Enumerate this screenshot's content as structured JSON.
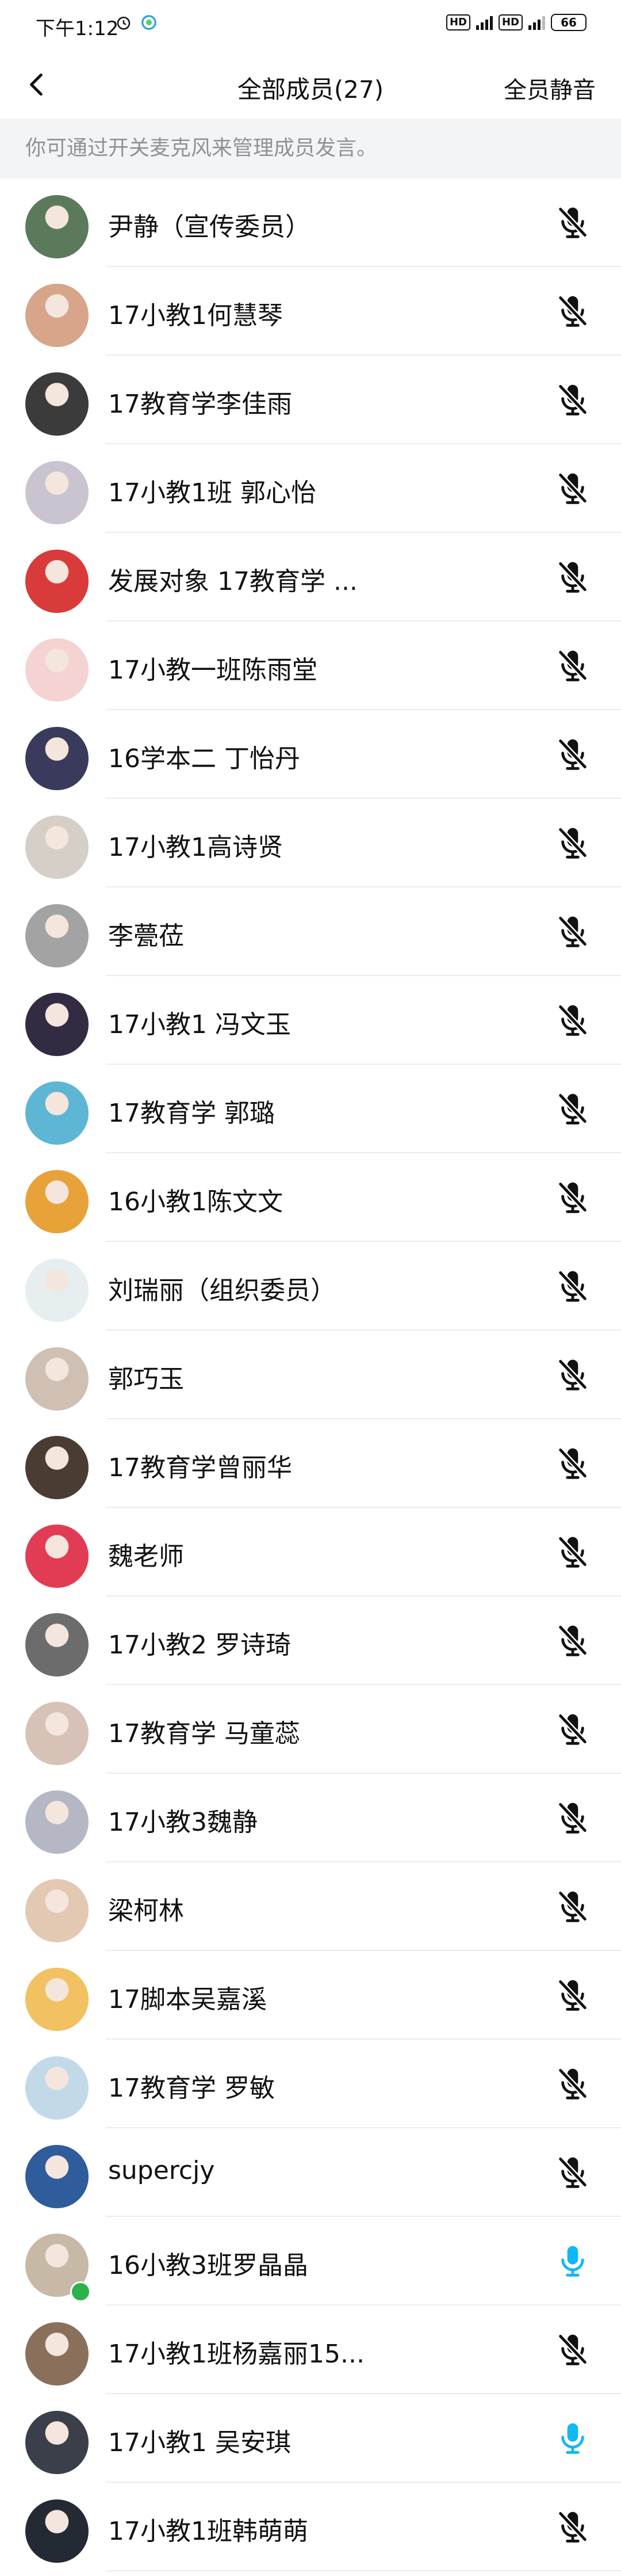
{
  "status": {
    "time": "下午1:12",
    "hd1": "HD",
    "hd2": "HD",
    "battery": "66"
  },
  "header": {
    "title": "全部成员(27)",
    "mute_all": "全员静音"
  },
  "hint": "你可通过开关麦克风来管理成员发言。",
  "members": [
    {
      "name": "尹静（宣传委员）",
      "mic": "muted",
      "avatar_color": "#5a7a5b"
    },
    {
      "name": "17小教1何慧琴",
      "mic": "muted",
      "avatar_color": "#d6a58a"
    },
    {
      "name": "17教育学李佳雨",
      "mic": "muted",
      "avatar_color": "#3b3b3b"
    },
    {
      "name": "17小教1班 郭心怡",
      "mic": "muted",
      "avatar_color": "#c9c4d0"
    },
    {
      "name": "发展对象 17教育学 ...",
      "mic": "muted",
      "avatar_color": "#d93a3a"
    },
    {
      "name": "17小教一班陈雨堂",
      "mic": "muted",
      "avatar_color": "#f5d3d3"
    },
    {
      "name": "16学本二 丁怡丹",
      "mic": "muted",
      "avatar_color": "#3a3a5c"
    },
    {
      "name": "17小教1高诗贤",
      "mic": "muted",
      "avatar_color": "#d6cfc7"
    },
    {
      "name": "李甍莅",
      "mic": "muted",
      "avatar_color": "#a3a3a3"
    },
    {
      "name": "17小教1 冯文玉",
      "mic": "muted",
      "avatar_color": "#322b42"
    },
    {
      "name": "17教育学 郭璐",
      "mic": "muted",
      "avatar_color": "#5eb6d5"
    },
    {
      "name": "16小教1陈文文",
      "mic": "muted",
      "avatar_color": "#e8a23a"
    },
    {
      "name": "刘瑞丽（组织委员）",
      "mic": "muted",
      "avatar_color": "#e7eef0"
    },
    {
      "name": "郭巧玉",
      "mic": "muted",
      "avatar_color": "#cfc0b3"
    },
    {
      "name": "17教育学曾丽华",
      "mic": "muted",
      "avatar_color": "#4a3c32"
    },
    {
      "name": "魏老师",
      "mic": "muted",
      "avatar_color": "#e23c55"
    },
    {
      "name": "17小教2 罗诗琦",
      "mic": "muted",
      "avatar_color": "#6c6c6c"
    },
    {
      "name": "17教育学 马童蕊",
      "mic": "muted",
      "avatar_color": "#d7c2b7"
    },
    {
      "name": "17小教3魏静",
      "mic": "muted",
      "avatar_color": "#b5b7c4"
    },
    {
      "name": "梁柯林",
      "mic": "muted",
      "avatar_color": "#e3c9b2"
    },
    {
      "name": "17脚本吴嘉溪",
      "mic": "muted",
      "avatar_color": "#f2c161"
    },
    {
      "name": "17教育学 罗敏",
      "mic": "muted",
      "avatar_color": "#c2d9e8"
    },
    {
      "name": "supercjy",
      "mic": "muted",
      "avatar_color": "#2f5c9a"
    },
    {
      "name": "16小教3班罗晶晶",
      "mic": "on",
      "avatar_color": "#c7b9a6",
      "badge": true
    },
    {
      "name": "17小教1班杨嘉丽15...",
      "mic": "muted",
      "avatar_color": "#8a6f5b"
    },
    {
      "name": "17小教1 吴安琪",
      "mic": "on",
      "avatar_color": "#3a3f4a"
    },
    {
      "name": "17小教1班韩萌萌",
      "mic": "muted",
      "avatar_color": "#232a33"
    }
  ],
  "colors": {
    "mic_on": "#12b7f5",
    "mic_off": "#111111",
    "hint_bg": "#f3f4f6",
    "hint_text": "#8e9196"
  },
  "icons": {
    "back": "chevron-left-icon",
    "mic_on": "microphone-icon",
    "mic_off": "microphone-muted-icon"
  }
}
